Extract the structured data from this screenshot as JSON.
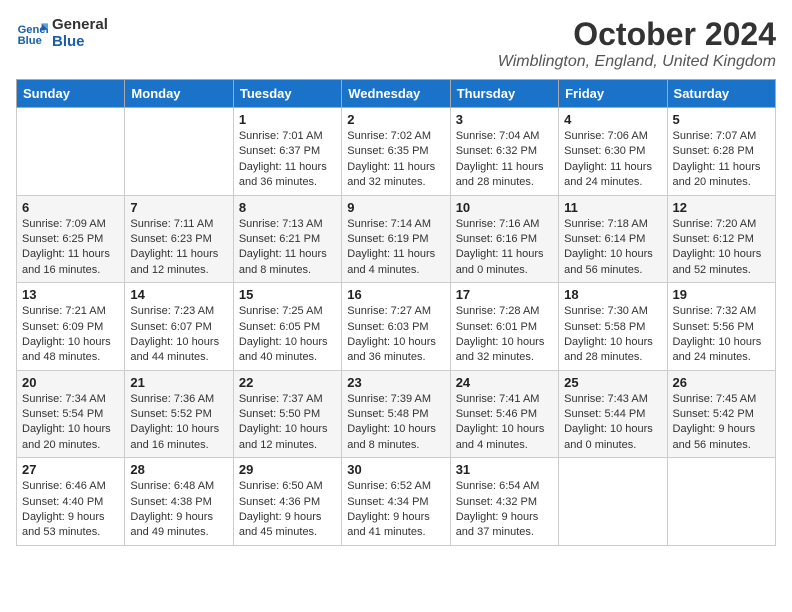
{
  "logo": {
    "line1": "General",
    "line2": "Blue"
  },
  "title": "October 2024",
  "location": "Wimblington, England, United Kingdom",
  "days_of_week": [
    "Sunday",
    "Monday",
    "Tuesday",
    "Wednesday",
    "Thursday",
    "Friday",
    "Saturday"
  ],
  "weeks": [
    [
      {
        "day": "",
        "text": ""
      },
      {
        "day": "",
        "text": ""
      },
      {
        "day": "1",
        "text": "Sunrise: 7:01 AM\nSunset: 6:37 PM\nDaylight: 11 hours and 36 minutes."
      },
      {
        "day": "2",
        "text": "Sunrise: 7:02 AM\nSunset: 6:35 PM\nDaylight: 11 hours and 32 minutes."
      },
      {
        "day": "3",
        "text": "Sunrise: 7:04 AM\nSunset: 6:32 PM\nDaylight: 11 hours and 28 minutes."
      },
      {
        "day": "4",
        "text": "Sunrise: 7:06 AM\nSunset: 6:30 PM\nDaylight: 11 hours and 24 minutes."
      },
      {
        "day": "5",
        "text": "Sunrise: 7:07 AM\nSunset: 6:28 PM\nDaylight: 11 hours and 20 minutes."
      }
    ],
    [
      {
        "day": "6",
        "text": "Sunrise: 7:09 AM\nSunset: 6:25 PM\nDaylight: 11 hours and 16 minutes."
      },
      {
        "day": "7",
        "text": "Sunrise: 7:11 AM\nSunset: 6:23 PM\nDaylight: 11 hours and 12 minutes."
      },
      {
        "day": "8",
        "text": "Sunrise: 7:13 AM\nSunset: 6:21 PM\nDaylight: 11 hours and 8 minutes."
      },
      {
        "day": "9",
        "text": "Sunrise: 7:14 AM\nSunset: 6:19 PM\nDaylight: 11 hours and 4 minutes."
      },
      {
        "day": "10",
        "text": "Sunrise: 7:16 AM\nSunset: 6:16 PM\nDaylight: 11 hours and 0 minutes."
      },
      {
        "day": "11",
        "text": "Sunrise: 7:18 AM\nSunset: 6:14 PM\nDaylight: 10 hours and 56 minutes."
      },
      {
        "day": "12",
        "text": "Sunrise: 7:20 AM\nSunset: 6:12 PM\nDaylight: 10 hours and 52 minutes."
      }
    ],
    [
      {
        "day": "13",
        "text": "Sunrise: 7:21 AM\nSunset: 6:09 PM\nDaylight: 10 hours and 48 minutes."
      },
      {
        "day": "14",
        "text": "Sunrise: 7:23 AM\nSunset: 6:07 PM\nDaylight: 10 hours and 44 minutes."
      },
      {
        "day": "15",
        "text": "Sunrise: 7:25 AM\nSunset: 6:05 PM\nDaylight: 10 hours and 40 minutes."
      },
      {
        "day": "16",
        "text": "Sunrise: 7:27 AM\nSunset: 6:03 PM\nDaylight: 10 hours and 36 minutes."
      },
      {
        "day": "17",
        "text": "Sunrise: 7:28 AM\nSunset: 6:01 PM\nDaylight: 10 hours and 32 minutes."
      },
      {
        "day": "18",
        "text": "Sunrise: 7:30 AM\nSunset: 5:58 PM\nDaylight: 10 hours and 28 minutes."
      },
      {
        "day": "19",
        "text": "Sunrise: 7:32 AM\nSunset: 5:56 PM\nDaylight: 10 hours and 24 minutes."
      }
    ],
    [
      {
        "day": "20",
        "text": "Sunrise: 7:34 AM\nSunset: 5:54 PM\nDaylight: 10 hours and 20 minutes."
      },
      {
        "day": "21",
        "text": "Sunrise: 7:36 AM\nSunset: 5:52 PM\nDaylight: 10 hours and 16 minutes."
      },
      {
        "day": "22",
        "text": "Sunrise: 7:37 AM\nSunset: 5:50 PM\nDaylight: 10 hours and 12 minutes."
      },
      {
        "day": "23",
        "text": "Sunrise: 7:39 AM\nSunset: 5:48 PM\nDaylight: 10 hours and 8 minutes."
      },
      {
        "day": "24",
        "text": "Sunrise: 7:41 AM\nSunset: 5:46 PM\nDaylight: 10 hours and 4 minutes."
      },
      {
        "day": "25",
        "text": "Sunrise: 7:43 AM\nSunset: 5:44 PM\nDaylight: 10 hours and 0 minutes."
      },
      {
        "day": "26",
        "text": "Sunrise: 7:45 AM\nSunset: 5:42 PM\nDaylight: 9 hours and 56 minutes."
      }
    ],
    [
      {
        "day": "27",
        "text": "Sunrise: 6:46 AM\nSunset: 4:40 PM\nDaylight: 9 hours and 53 minutes."
      },
      {
        "day": "28",
        "text": "Sunrise: 6:48 AM\nSunset: 4:38 PM\nDaylight: 9 hours and 49 minutes."
      },
      {
        "day": "29",
        "text": "Sunrise: 6:50 AM\nSunset: 4:36 PM\nDaylight: 9 hours and 45 minutes."
      },
      {
        "day": "30",
        "text": "Sunrise: 6:52 AM\nSunset: 4:34 PM\nDaylight: 9 hours and 41 minutes."
      },
      {
        "day": "31",
        "text": "Sunrise: 6:54 AM\nSunset: 4:32 PM\nDaylight: 9 hours and 37 minutes."
      },
      {
        "day": "",
        "text": ""
      },
      {
        "day": "",
        "text": ""
      }
    ]
  ]
}
